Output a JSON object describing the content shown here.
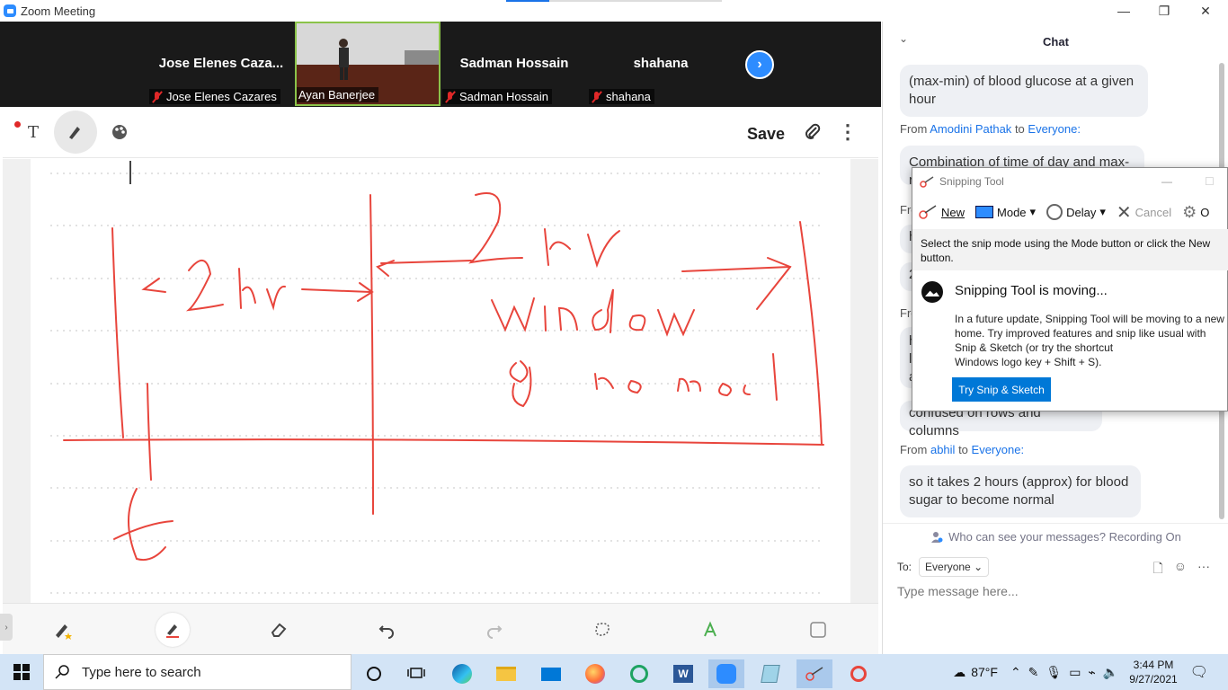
{
  "window": {
    "title": "Zoom Meeting",
    "minimize": "—",
    "restore": "❐",
    "close": "✕"
  },
  "participants": [
    {
      "big_name": "Jose  Elenes  Caza...",
      "tag": "Jose Elenes Cazares",
      "muted": true
    },
    {
      "big_name": "",
      "tag": "Ayan Banerjee",
      "muted": false,
      "active": true
    },
    {
      "big_name": "Sadman Hossain",
      "tag": "Sadman Hossain",
      "muted": true
    },
    {
      "big_name": "shahana",
      "tag": "shahana",
      "muted": true
    }
  ],
  "whiteboard": {
    "toolbar": {
      "text_icon": "T",
      "save_label": "Save"
    }
  },
  "chat": {
    "header": "Chat",
    "messages": [
      {
        "text": "(max-min) of blood glucose at a given hour"
      },
      {
        "from_prefix": "From",
        "sender": "Amodini Pathak",
        "to_word": "to",
        "recipient": "Everyone:",
        "text": "Combination of time of day and max-"
      },
      {
        "partial_from": "Fro",
        "partial_1": "h",
        "partial_2": "2"
      },
      {
        "partial_from": "Fro",
        "partial_1": "h",
        "partial_2": "l",
        "partial_3": "a"
      },
      {
        "text": "confused on rows and columns"
      },
      {
        "from_prefix": "From",
        "sender": "abhil",
        "to_word": "to",
        "recipient": "Everyone:",
        "text": "so it takes 2 hours (approx) for blood sugar to become normal"
      }
    ],
    "visibility_note": "Who can see your messages? Recording On",
    "to_label": "To:",
    "to_value": "Everyone",
    "placeholder": "Type message here..."
  },
  "snipping_tool": {
    "title": "Snipping Tool",
    "new_label": "New",
    "mode_label": "Mode",
    "delay_label": "Delay",
    "cancel_label": "Cancel",
    "options_label": "O",
    "hint": "Select the snip mode using the Mode button or click the New button.",
    "moving_title": "Snipping Tool is moving...",
    "moving_body_1": "In a future update, Snipping Tool will be moving to a new home. Try improved features and snip like usual with Snip & Sketch (or try the shortcut",
    "moving_body_2": "Windows logo key + Shift + S).",
    "try_button": "Try Snip & Sketch"
  },
  "taskbar": {
    "search_placeholder": "Type here to search",
    "weather": "87°F",
    "time": "3:44 PM",
    "date": "9/27/2021"
  },
  "colors": {
    "zoom_blue": "#2d8cff",
    "ink_red": "#e8453c",
    "active_border": "#8bc34a",
    "win_blue": "#0078d7"
  }
}
